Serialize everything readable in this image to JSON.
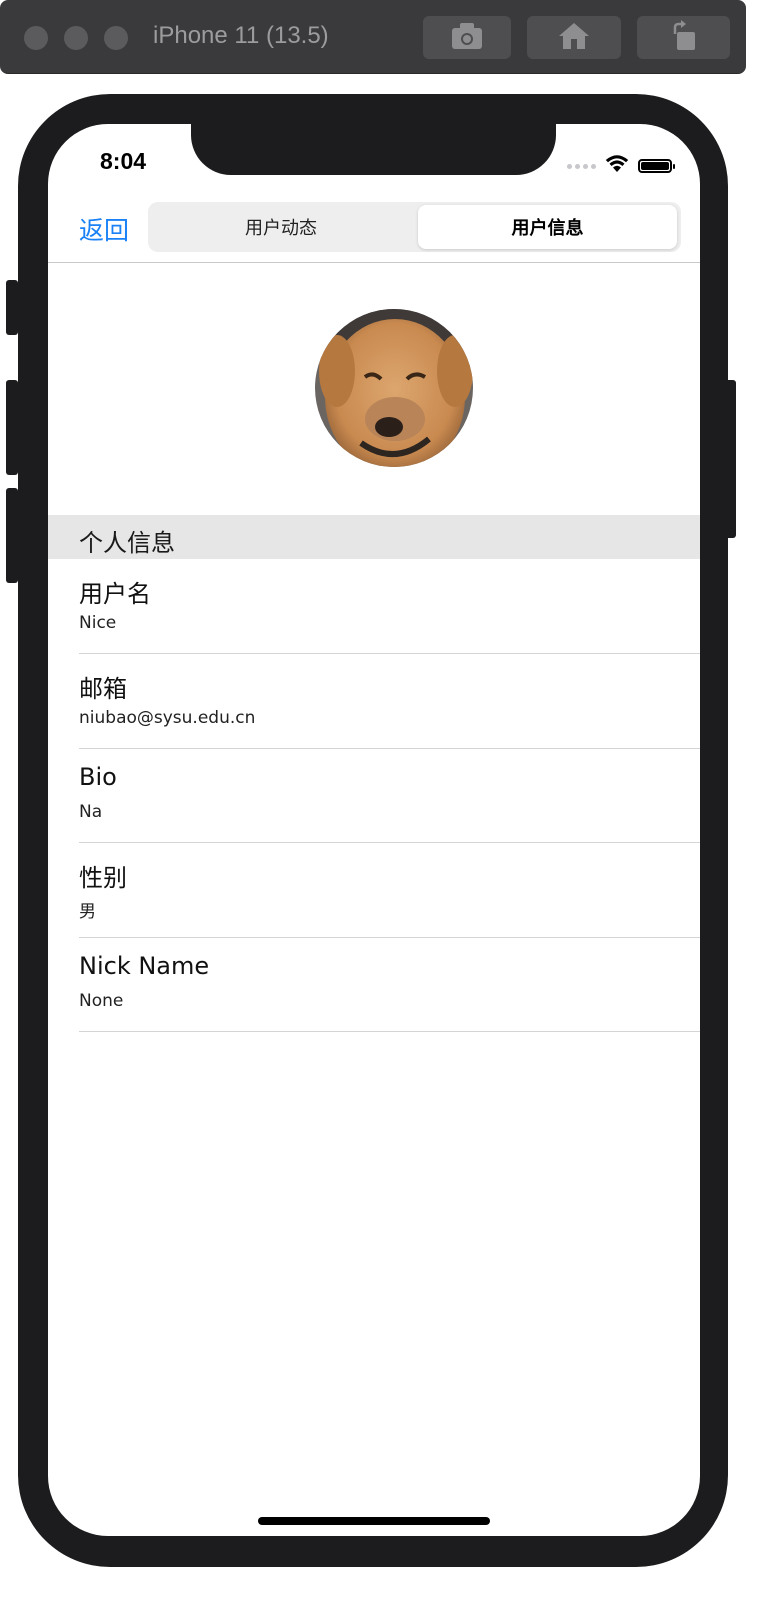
{
  "window": {
    "title": "iPhone 11 (13.5)"
  },
  "status_bar": {
    "time": "8:04"
  },
  "nav": {
    "back_label": "返回",
    "segments": [
      "用户动态",
      "用户信息"
    ],
    "selected_segment": "用户信息"
  },
  "section": {
    "title": "个人信息"
  },
  "rows": [
    {
      "title": "用户名",
      "value": "Nice"
    },
    {
      "title": "邮箱",
      "value": "niubao@sysu.edu.cn"
    },
    {
      "title": "Bio",
      "value": "Na"
    },
    {
      "title": "性别",
      "value": "男"
    },
    {
      "title": "Nick Name",
      "value": "None"
    }
  ],
  "colors": {
    "accent": "#1a82f6",
    "section_bg": "#e6e6e7",
    "frame": "#1c1c1e"
  },
  "icons": {
    "toolbar": [
      "screenshot-icon",
      "home-icon",
      "rotate-icon"
    ],
    "status": [
      "cellular-signal-icon",
      "wifi-icon",
      "battery-icon"
    ]
  }
}
